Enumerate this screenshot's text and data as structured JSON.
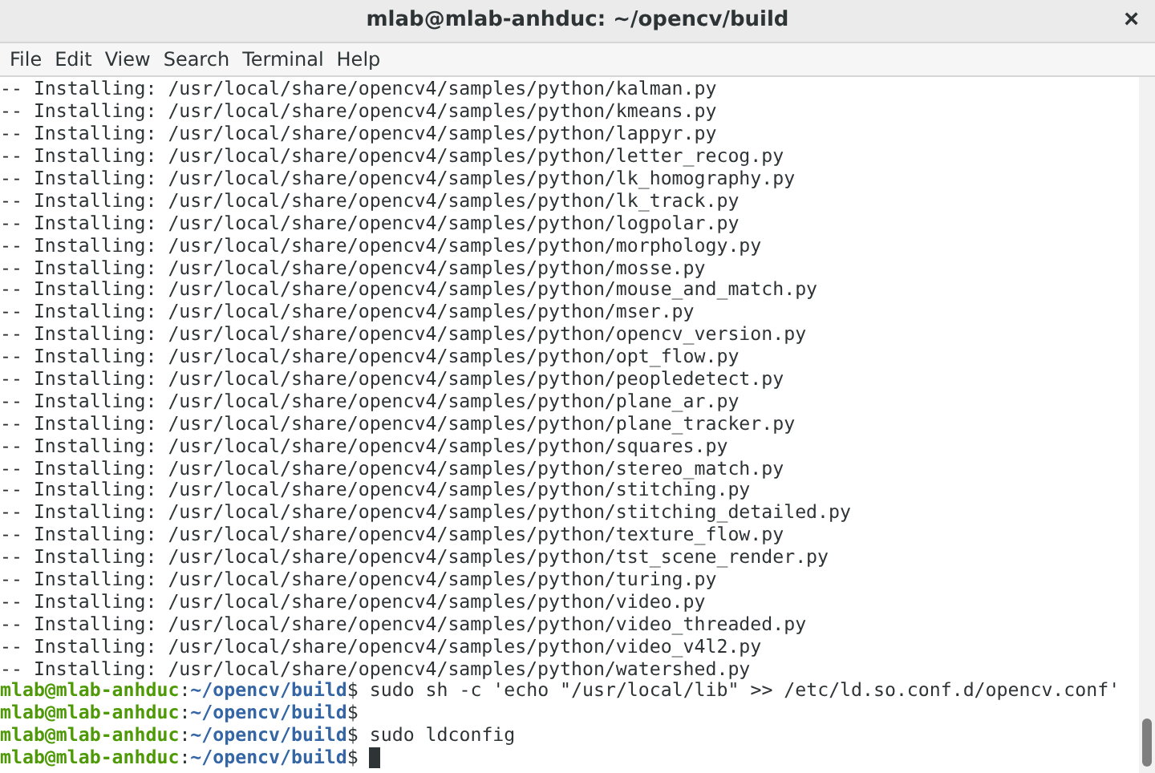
{
  "window": {
    "title": "mlab@mlab-anhduc: ~/opencv/build",
    "close": "×"
  },
  "menu": [
    "File",
    "Edit",
    "View",
    "Search",
    "Terminal",
    "Help"
  ],
  "terminal": {
    "lines": [
      {
        "kind": "output",
        "text": "-- Installing: /usr/local/share/opencv4/samples/python/kalman.py"
      },
      {
        "kind": "output",
        "text": "-- Installing: /usr/local/share/opencv4/samples/python/kmeans.py"
      },
      {
        "kind": "output",
        "text": "-- Installing: /usr/local/share/opencv4/samples/python/lappyr.py"
      },
      {
        "kind": "output",
        "text": "-- Installing: /usr/local/share/opencv4/samples/python/letter_recog.py"
      },
      {
        "kind": "output",
        "text": "-- Installing: /usr/local/share/opencv4/samples/python/lk_homography.py"
      },
      {
        "kind": "output",
        "text": "-- Installing: /usr/local/share/opencv4/samples/python/lk_track.py"
      },
      {
        "kind": "output",
        "text": "-- Installing: /usr/local/share/opencv4/samples/python/logpolar.py"
      },
      {
        "kind": "output",
        "text": "-- Installing: /usr/local/share/opencv4/samples/python/morphology.py"
      },
      {
        "kind": "output",
        "text": "-- Installing: /usr/local/share/opencv4/samples/python/mosse.py"
      },
      {
        "kind": "output",
        "text": "-- Installing: /usr/local/share/opencv4/samples/python/mouse_and_match.py"
      },
      {
        "kind": "output",
        "text": "-- Installing: /usr/local/share/opencv4/samples/python/mser.py"
      },
      {
        "kind": "output",
        "text": "-- Installing: /usr/local/share/opencv4/samples/python/opencv_version.py"
      },
      {
        "kind": "output",
        "text": "-- Installing: /usr/local/share/opencv4/samples/python/opt_flow.py"
      },
      {
        "kind": "output",
        "text": "-- Installing: /usr/local/share/opencv4/samples/python/peopledetect.py"
      },
      {
        "kind": "output",
        "text": "-- Installing: /usr/local/share/opencv4/samples/python/plane_ar.py"
      },
      {
        "kind": "output",
        "text": "-- Installing: /usr/local/share/opencv4/samples/python/plane_tracker.py"
      },
      {
        "kind": "output",
        "text": "-- Installing: /usr/local/share/opencv4/samples/python/squares.py"
      },
      {
        "kind": "output",
        "text": "-- Installing: /usr/local/share/opencv4/samples/python/stereo_match.py"
      },
      {
        "kind": "output",
        "text": "-- Installing: /usr/local/share/opencv4/samples/python/stitching.py"
      },
      {
        "kind": "output",
        "text": "-- Installing: /usr/local/share/opencv4/samples/python/stitching_detailed.py"
      },
      {
        "kind": "output",
        "text": "-- Installing: /usr/local/share/opencv4/samples/python/texture_flow.py"
      },
      {
        "kind": "output",
        "text": "-- Installing: /usr/local/share/opencv4/samples/python/tst_scene_render.py"
      },
      {
        "kind": "output",
        "text": "-- Installing: /usr/local/share/opencv4/samples/python/turing.py"
      },
      {
        "kind": "output",
        "text": "-- Installing: /usr/local/share/opencv4/samples/python/video.py"
      },
      {
        "kind": "output",
        "text": "-- Installing: /usr/local/share/opencv4/samples/python/video_threaded.py"
      },
      {
        "kind": "output",
        "text": "-- Installing: /usr/local/share/opencv4/samples/python/video_v4l2.py"
      },
      {
        "kind": "output",
        "text": "-- Installing: /usr/local/share/opencv4/samples/python/watershed.py"
      },
      {
        "kind": "prompt",
        "user": "mlab@mlab-anhduc",
        "sep": ":",
        "path": "~/opencv/build",
        "sign": "$",
        "command": "sudo sh -c 'echo \"/usr/local/lib\" >> /etc/ld.so.conf.d/opencv.conf'"
      },
      {
        "kind": "prompt",
        "user": "mlab@mlab-anhduc",
        "sep": ":",
        "path": "~/opencv/build",
        "sign": "$"
      },
      {
        "kind": "prompt",
        "user": "mlab@mlab-anhduc",
        "sep": ":",
        "path": "~/opencv/build",
        "sign": "$",
        "command": "sudo ldconfig"
      },
      {
        "kind": "prompt",
        "user": "mlab@mlab-anhduc",
        "sep": ":",
        "path": "~/opencv/build",
        "sign": "$",
        "cursor": true
      }
    ]
  }
}
